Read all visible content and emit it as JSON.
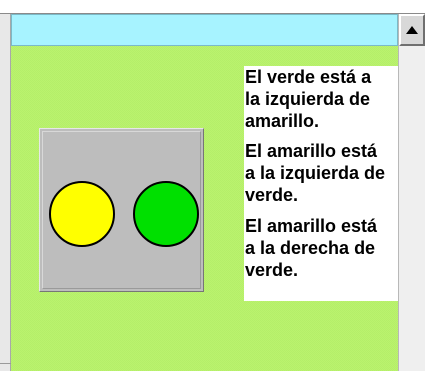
{
  "colors": {
    "header_band": "#a7f3ff",
    "content_background": "#baf36e",
    "light_box": "#bdbdbd",
    "yellow_light": "#ffff00",
    "green_light": "#00e000",
    "panel_background": "#ffffff",
    "panel_text": "#000000"
  },
  "icons": {
    "scroll_up": "triangle-up"
  },
  "statements": [
    "El verde está a\nla izquierda de\namarillo.",
    "El amarillo está\na la izquierda de\nverde.",
    "El amarillo está\na la derecha de\nverde."
  ]
}
